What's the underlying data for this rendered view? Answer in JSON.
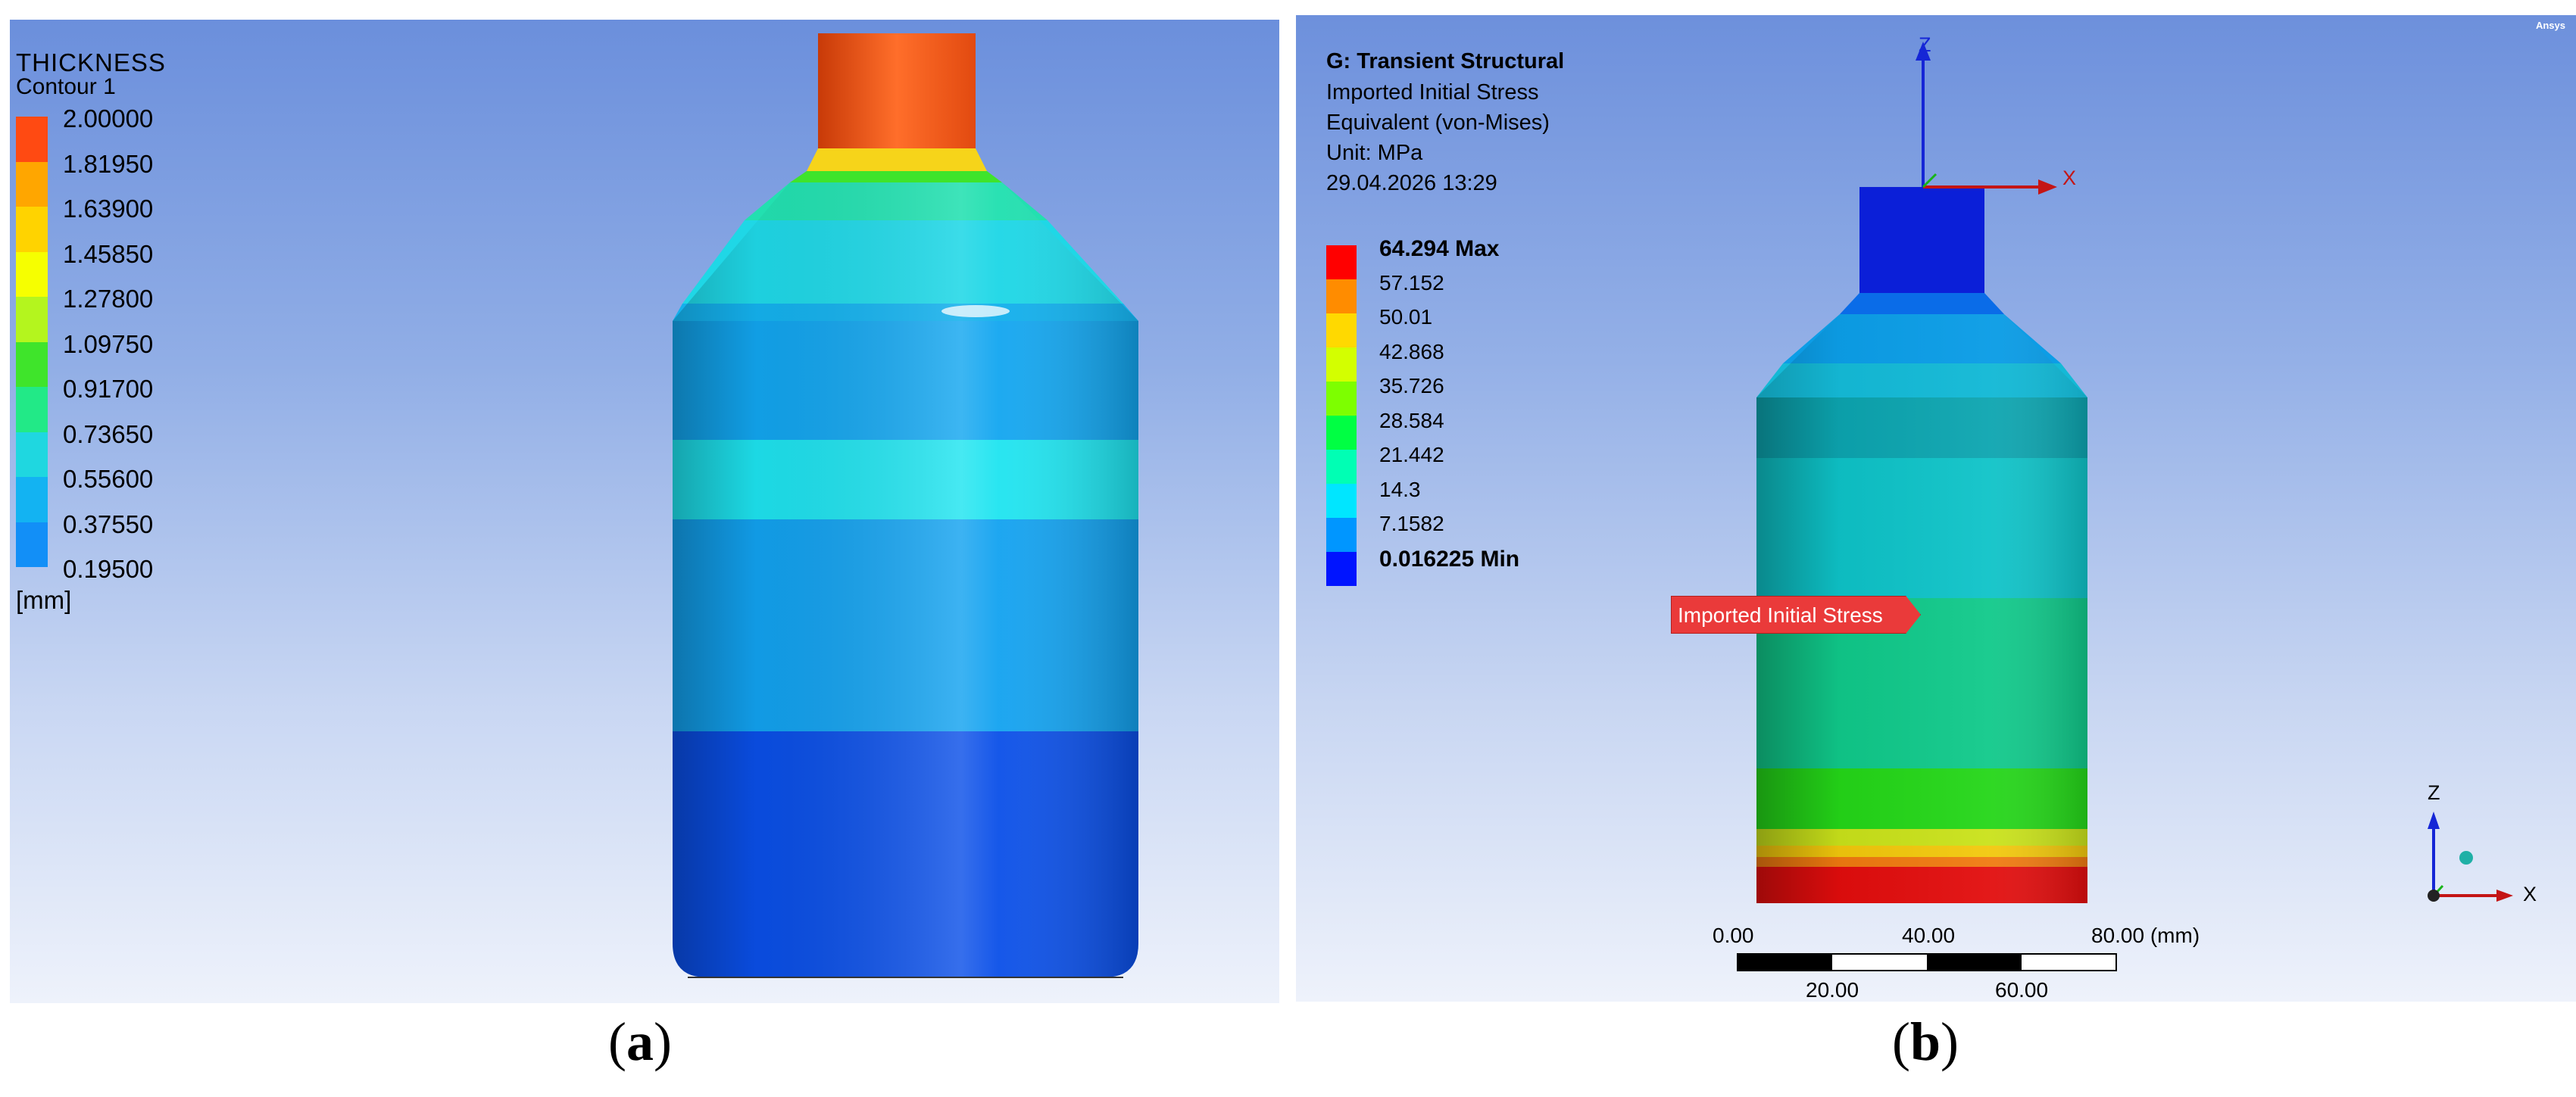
{
  "panel_a": {
    "legend": {
      "title": "THICKNESS",
      "subtitle": "Contour 1",
      "values": [
        "2.00000",
        "1.81950",
        "1.63900",
        "1.45850",
        "1.27800",
        "1.09750",
        "0.91700",
        "0.73650",
        "0.55600",
        "0.37550",
        "0.19500"
      ],
      "unit": "[mm]",
      "colors": [
        "#ff4a12",
        "#ffa600",
        "#ffd300",
        "#f6ff00",
        "#b4f51e",
        "#3fe42b",
        "#22e987",
        "#1fd7e0",
        "#13b3f2",
        "#128ff7",
        "#0a55ee"
      ]
    },
    "caption_letter": "a"
  },
  "panel_b": {
    "header": {
      "analysis": "G: Transient Structural",
      "result": "Imported Initial Stress",
      "type": "Equivalent (von-Mises)",
      "unit": "Unit: MPa",
      "timestamp": "29.04.2026 13:29"
    },
    "legend": {
      "max": "64.294 Max",
      "values": [
        "57.152",
        "50.01",
        "42.868",
        "35.726",
        "28.584",
        "21.442",
        "14.3",
        "7.1582"
      ],
      "min": "0.016225 Min",
      "colors": [
        "#ff0000",
        "#ff8c00",
        "#ffd900",
        "#d3ff00",
        "#7dff00",
        "#00ff43",
        "#00ffb4",
        "#00e6ff",
        "#0096ff",
        "#0014ff"
      ]
    },
    "logo": "Ansys",
    "callout": "Imported Initial Stress",
    "triad": {
      "z": "Z",
      "x": "X"
    },
    "scale_bar": {
      "top_labels": [
        "0.00",
        "40.00",
        "80.00 (mm)"
      ],
      "bottom_labels": [
        "20.00",
        "60.00"
      ]
    },
    "caption_letter": "b"
  }
}
